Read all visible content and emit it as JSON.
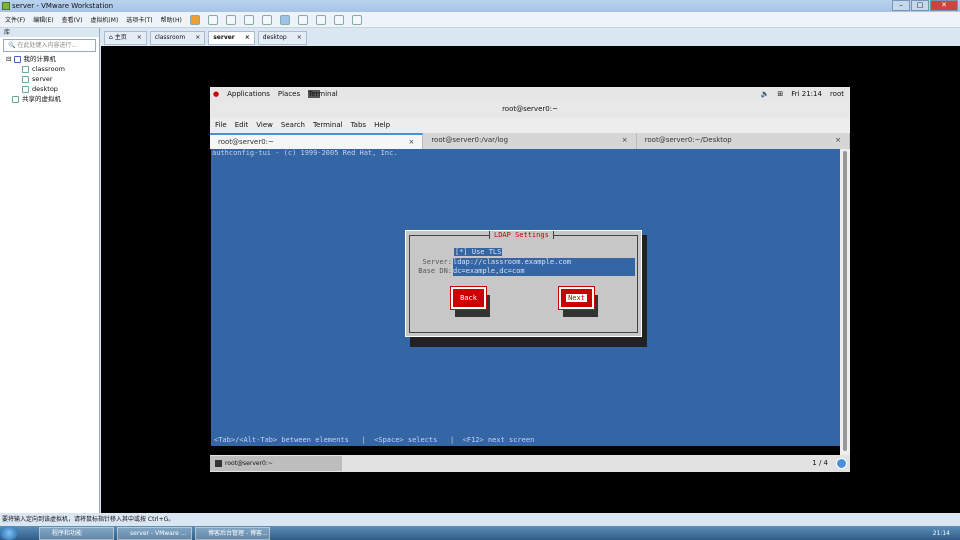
{
  "window": {
    "title": "server - VMware Workstation"
  },
  "menu": [
    "文件(F)",
    "编辑(E)",
    "查看(V)",
    "虚拟机(M)",
    "选项卡(T)",
    "帮助(H)"
  ],
  "library": {
    "header": "库",
    "search_placeholder": "在此处键入内容进行...",
    "tree": {
      "root": "我的计算机",
      "vms": [
        "classroom",
        "server",
        "desktop"
      ],
      "shared": "共享的虚拟机"
    }
  },
  "tabs": [
    {
      "label": "主页"
    },
    {
      "label": "classroom"
    },
    {
      "label": "server"
    },
    {
      "label": "desktop"
    }
  ],
  "guest": {
    "topbar": {
      "applications": "Applications",
      "places": "Places",
      "app": "Terminal",
      "clock": "Fri 21:14",
      "user": "root"
    },
    "title": "root@server0:~",
    "menu": [
      "File",
      "Edit",
      "View",
      "Search",
      "Terminal",
      "Tabs",
      "Help"
    ],
    "tabs": [
      "root@server0:~",
      "root@server0:/var/log",
      "root@server0:~/Desktop"
    ],
    "terminal": {
      "header": "authconfig-tui - (c) 1999-2005 Red Hat, Inc.",
      "dialog": {
        "title": "LDAP Settings",
        "use_tls": "[*] Use TLS",
        "server_label": "Server:",
        "server_value": "ldap://classroom.example.com",
        "basedn_label": "Base DN:",
        "basedn_value": "dc=example,dc=com",
        "back": "Back",
        "next": "Next"
      },
      "footer": "<Tab>/<Alt-Tab> between elements   |  <Space> selects   |  <F12> next screen"
    },
    "bottom": {
      "task": "root@server0:~",
      "workspace": "1 / 4"
    }
  },
  "status": "要将输入定向到该虚拟机，请将鼠标指针移入其中或按 Ctrl+G。",
  "taskbar": {
    "items": [
      "程序和功能",
      "server - VMware ...",
      "博客后台管理 - 博客..."
    ],
    "clock": "21:14"
  }
}
